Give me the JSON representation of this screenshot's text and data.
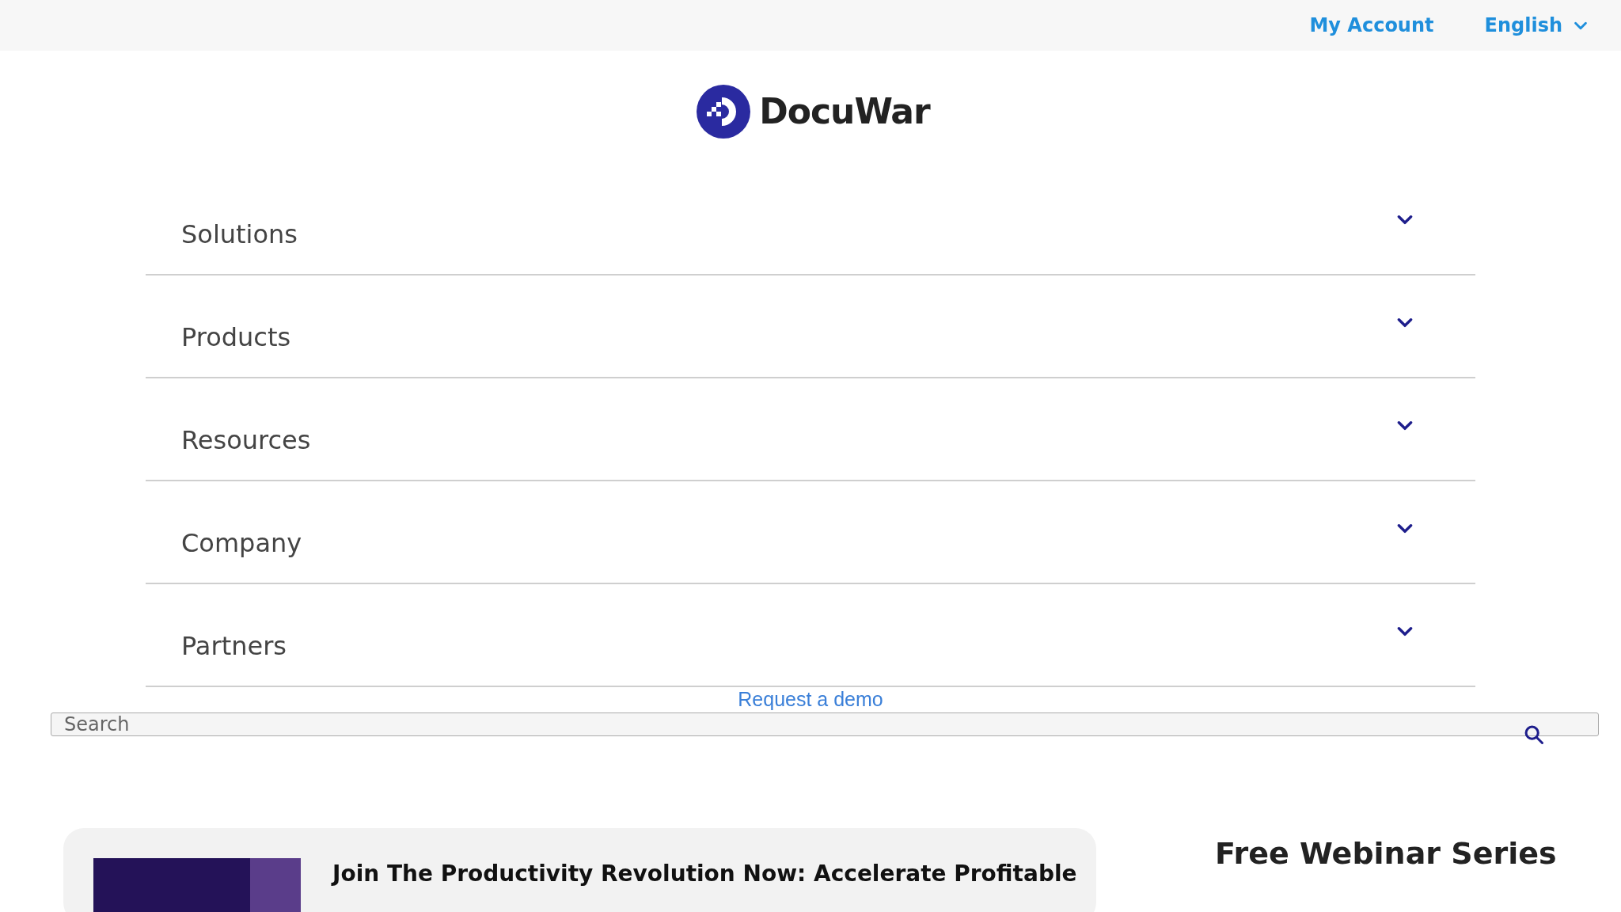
{
  "top_bar": {
    "account_link": "My Account",
    "language": {
      "label": "English",
      "expanded": false
    }
  },
  "logo": {
    "text": "DocuWar"
  },
  "nav": [
    {
      "label": "Solutions",
      "expanded": false
    },
    {
      "label": "Products",
      "expanded": false
    },
    {
      "label": "Resources",
      "expanded": false
    },
    {
      "label": "Company",
      "expanded": false
    },
    {
      "label": "Partners",
      "expanded": false
    }
  ],
  "demo_link": "Request a demo",
  "search": {
    "placeholder": "Search"
  },
  "feature_card": {
    "title": "Join The Productivity Revolution Now: Accelerate Profitable"
  },
  "sidebar": {
    "heading": "Free Webinar Series"
  }
}
